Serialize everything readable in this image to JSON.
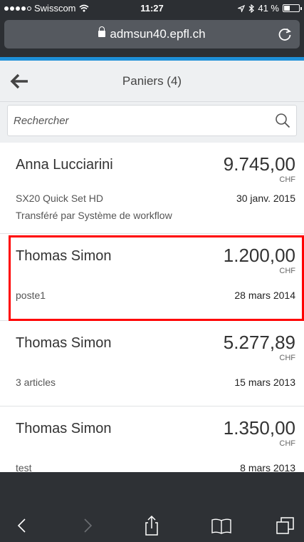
{
  "status": {
    "carrier": "Swisscom",
    "time": "11:27",
    "battery": "41 %",
    "battery_level": 0.41
  },
  "browser": {
    "url": "admsun40.epfl.ch"
  },
  "header": {
    "title": "Paniers (4)"
  },
  "search": {
    "placeholder": "Rechercher"
  },
  "carts": [
    {
      "name": "Anna Lucciarini",
      "amount": "9.745,00",
      "currency": "CHF",
      "description": "SX20 Quick Set HD",
      "date": "30 janv. 2015",
      "note": "Transféré par Système de workflow"
    },
    {
      "name": "Thomas Simon",
      "amount": "1.200,00",
      "currency": "CHF",
      "description": "poste1",
      "date": "28 mars 2014"
    },
    {
      "name": "Thomas Simon",
      "amount": "5.277,89",
      "currency": "CHF",
      "description": "3 articles",
      "date": "15 mars 2013"
    },
    {
      "name": "Thomas Simon",
      "amount": "1.350,00",
      "currency": "CHF",
      "description": "test",
      "date": "8 mars 2013"
    }
  ],
  "icons": {
    "back": "arrow-left-icon",
    "search": "magnifier-icon",
    "reload": "reload-icon",
    "lock": "lock-icon"
  },
  "colors": {
    "accent": "#1e90d8",
    "highlight": "#ff0000",
    "chrome": "#2c2f33"
  }
}
